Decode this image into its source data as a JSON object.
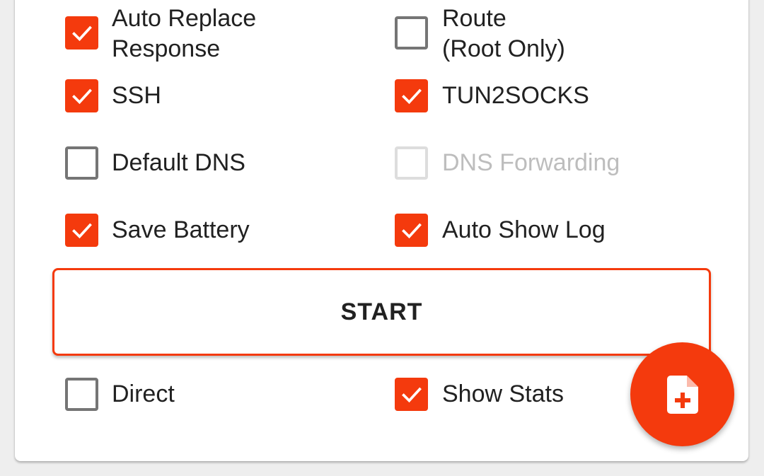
{
  "options": {
    "auto_replace_response": {
      "label_line1": "Auto Replace",
      "label_line2": "Response",
      "checked": true
    },
    "route_root_only": {
      "label_line1": "Route",
      "label_line2": "(Root Only)",
      "checked": false
    },
    "ssh": {
      "label": "SSH",
      "checked": true
    },
    "tun2socks": {
      "label": "TUN2SOCKS",
      "checked": true
    },
    "default_dns": {
      "label": "Default DNS",
      "checked": false
    },
    "dns_forwarding": {
      "label": "DNS Forwarding",
      "checked": false,
      "enabled": false
    },
    "save_battery": {
      "label": "Save Battery",
      "checked": true
    },
    "auto_show_log": {
      "label": "Auto Show Log",
      "checked": true
    },
    "direct": {
      "label": "Direct",
      "checked": false
    },
    "show_stats": {
      "label": "Show Stats",
      "checked": true
    }
  },
  "start_button": {
    "label": "START"
  },
  "fab": {
    "icon": "new-file-icon"
  },
  "colors": {
    "accent": "#f43a0d",
    "checkbox_unchecked_border": "#757575",
    "checkbox_disabled_border": "#dddddd",
    "text_primary": "#212121",
    "text_disabled": "#bdbdbd",
    "card_background": "#ffffff",
    "page_background": "#eeeeee"
  }
}
